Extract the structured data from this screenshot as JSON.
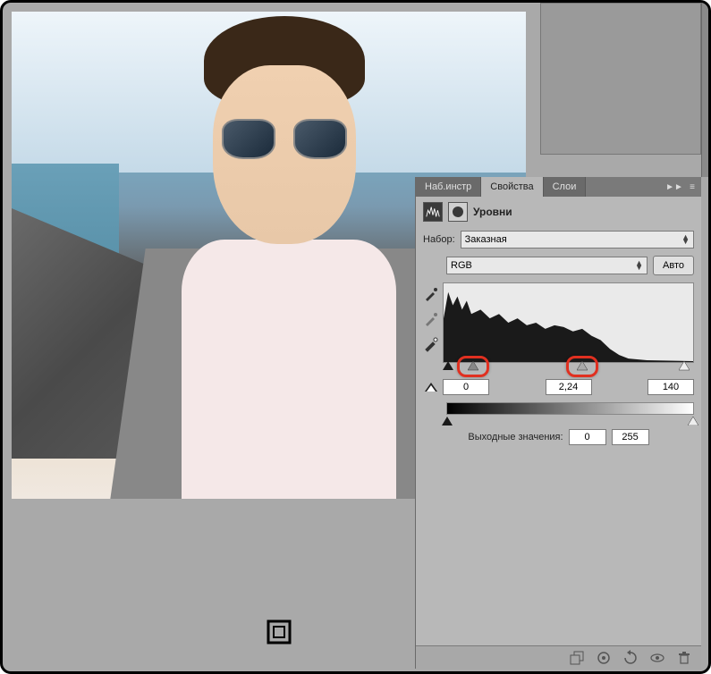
{
  "tabs": {
    "presets": "Наб.инстр",
    "properties": "Свойства",
    "layers": "Слои"
  },
  "panel": {
    "title": "Уровни",
    "preset_label": "Набор:",
    "preset_value": "Заказная",
    "channel_value": "RGB",
    "auto_button": "Авто",
    "input_black": "0",
    "input_gamma": "2,24",
    "input_white": "140",
    "output_label": "Выходные значения:",
    "output_black": "0",
    "output_white": "255"
  },
  "icons": {
    "collapse": "►►",
    "menu": "≡"
  }
}
